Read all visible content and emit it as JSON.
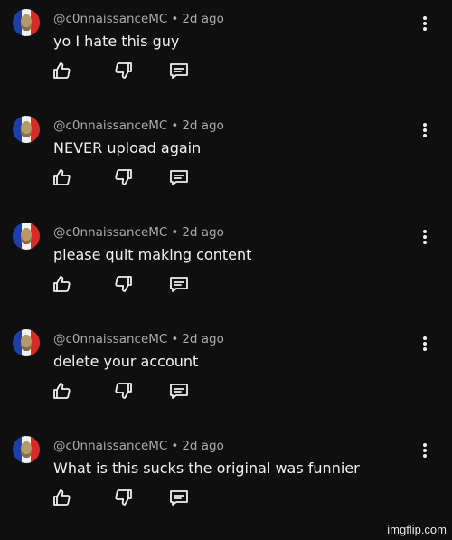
{
  "comments": [
    {
      "author": "@c0nnaissanceMC",
      "separator": "•",
      "time": "2d ago",
      "text": "yo I hate this guy"
    },
    {
      "author": "@c0nnaissanceMC",
      "separator": "•",
      "time": "2d ago",
      "text": "NEVER upload again"
    },
    {
      "author": "@c0nnaissanceMC",
      "separator": "•",
      "time": "2d ago",
      "text": "please quit making content"
    },
    {
      "author": "@c0nnaissanceMC",
      "separator": "•",
      "time": "2d ago",
      "text": "delete your account"
    },
    {
      "author": "@c0nnaissanceMC",
      "separator": "•",
      "time": "2d ago",
      "text": "What is this sucks the original was funnier"
    }
  ],
  "icons": {
    "like": "thumbs-up-icon",
    "dislike": "thumbs-down-icon",
    "reply": "reply-comment-icon",
    "menu": "more-vertical-icon"
  },
  "colors": {
    "background": "#0f0f0f",
    "text": "#f1f1f1",
    "meta": "#aaaaaa"
  },
  "watermark": "imgflip.com"
}
